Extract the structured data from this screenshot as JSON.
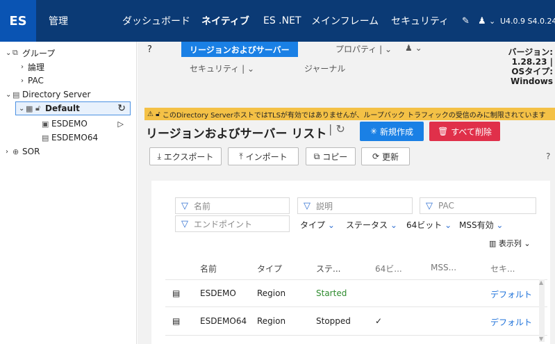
{
  "topbar": {
    "logo": "ES",
    "nav": [
      "管理",
      "ダッシュボード",
      "ネイティブ",
      "ES .NET",
      "メインフレーム",
      "セキュリティ"
    ],
    "active": "ネイティブ",
    "pin_icon": "pin-icon",
    "user_icon": "users-icon",
    "version": "U4.0.9 S4.0.24"
  },
  "sidebar": {
    "groups_label": "グループ",
    "logic": "論理",
    "pac": "PAC",
    "directory_server": "Directory Server",
    "default": "Default",
    "items": [
      "ESDEMO",
      "ESDEMO64"
    ],
    "sor": "SOR"
  },
  "tabs": {
    "regions": "リージョンおよびサーバー",
    "properties": "プロパティ",
    "security": "セキュリティ",
    "journal": "ジャーナル"
  },
  "version_box": {
    "label": "バージョン:",
    "version": "1.28.23 |",
    "os_label": "OSタイプ:",
    "os": "Windows"
  },
  "warning": "このDirectory ServerホストではTLSが有効ではありませんが、ループバック トラフィックの受信のみに制限されています",
  "list": {
    "title": "リージョンおよびサーバー リスト",
    "new": "新規作成",
    "delete_all": "すべて削除",
    "export": "エクスポート",
    "import": "インポート",
    "copy": "コピー",
    "refresh": "更新"
  },
  "filters": {
    "name": "名前",
    "description": "説明",
    "pac": "PAC",
    "endpoint": "エンドポイント",
    "type": "タイプ",
    "status": "ステータス",
    "bit64": "64ビット",
    "mss": "MSS有効",
    "columns": "表示列"
  },
  "table": {
    "headers": [
      "名前",
      "タイプ",
      "ステ...",
      "64ビ...",
      "MSS...",
      "セキ..."
    ],
    "rows": [
      {
        "name": "ESDEMO",
        "type": "Region",
        "status": "Started",
        "bit64": "",
        "mss": "",
        "security": "デフォルト"
      },
      {
        "name": "ESDEMO64",
        "type": "Region",
        "status": "Stopped",
        "bit64": "✓",
        "mss": "",
        "security": "デフォルト"
      }
    ]
  },
  "colors": {
    "topbar": "#0b3a75",
    "logo": "#0a54b3",
    "primary": "#1a80e5",
    "danger": "#e0304a",
    "warning": "#f4c146",
    "started": "#2e8b2e"
  }
}
